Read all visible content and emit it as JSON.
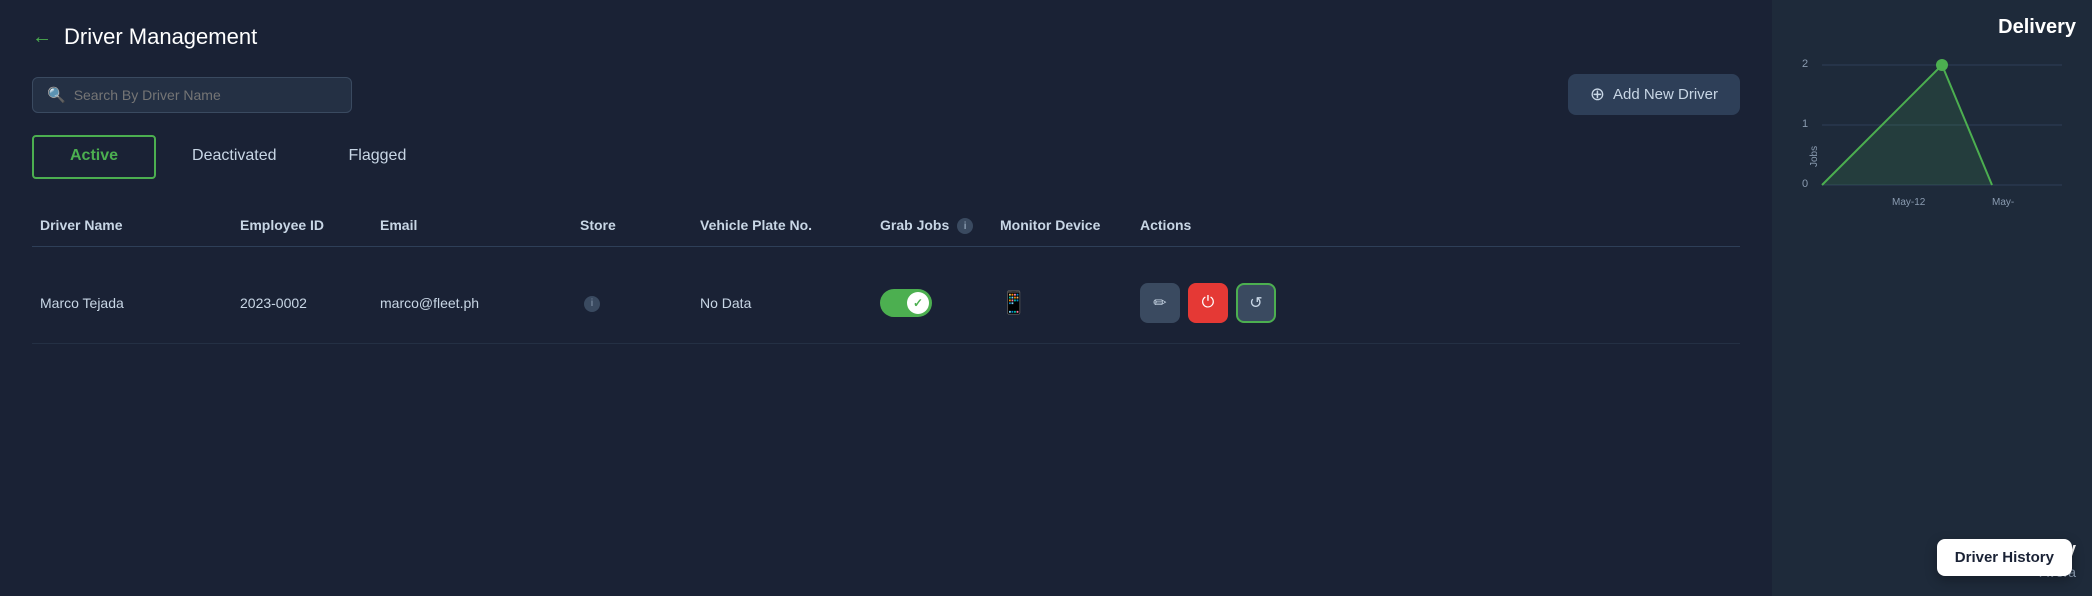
{
  "header": {
    "back_arrow": "←",
    "title": "Driver Management"
  },
  "toolbar": {
    "search_placeholder": "Search By Driver Name",
    "add_driver_label": "Add New Driver",
    "plus_symbol": "⊕"
  },
  "tabs": [
    {
      "id": "active",
      "label": "Active",
      "active": true
    },
    {
      "id": "deactivated",
      "label": "Deactivated",
      "active": false
    },
    {
      "id": "flagged",
      "label": "Flagged",
      "active": false
    }
  ],
  "table": {
    "columns": [
      {
        "id": "driver_name",
        "label": "Driver Name"
      },
      {
        "id": "employee_id",
        "label": "Employee ID"
      },
      {
        "id": "email",
        "label": "Email"
      },
      {
        "id": "store",
        "label": "Store"
      },
      {
        "id": "vehicle_plate",
        "label": "Vehicle Plate No."
      },
      {
        "id": "grab_jobs",
        "label": "Grab Jobs"
      },
      {
        "id": "monitor_device",
        "label": "Monitor Device"
      },
      {
        "id": "actions",
        "label": "Actions"
      }
    ],
    "rows": [
      {
        "driver_name": "Marco Tejada",
        "employee_id": "2023-0002",
        "email": "marco@fleet.ph",
        "store": "",
        "vehicle_plate": "No Data",
        "grab_jobs_active": true,
        "monitor_device": "phone",
        "actions": [
          "edit",
          "power",
          "history"
        ]
      }
    ]
  },
  "right_panel": {
    "title": "Delivery",
    "chart": {
      "y_labels": [
        "2",
        "1",
        "0"
      ],
      "x_labels": [
        "May-12",
        "May-"
      ],
      "data_points": []
    },
    "today_label": "Today",
    "avg_label": "Avera",
    "driver_history_tooltip": "Driver History"
  },
  "icons": {
    "search": "🔍",
    "plus": "⊕",
    "back": "←",
    "info": "i",
    "phone": "📱",
    "edit": "✏",
    "power": "⏻",
    "history": "↺",
    "check": "✓"
  }
}
